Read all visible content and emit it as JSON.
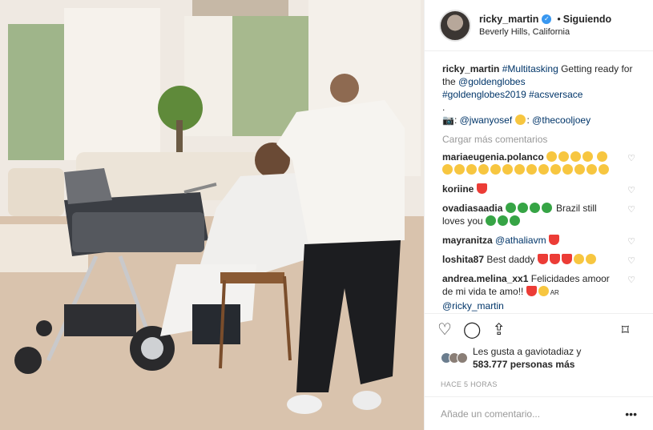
{
  "header": {
    "username": "ricky_martin",
    "separator": "•",
    "follow_status": "Siguiendo",
    "location": "Beverly Hills, California"
  },
  "caption": {
    "username": "ricky_martin",
    "hashtag1": "#Multitasking",
    "text1": " Getting ready for the ",
    "mention1": "@goldenglobes",
    "hashtag2": "#goldenglobes2019",
    "hashtag3": "#acsversace",
    "dot_line": ".",
    "camera": "📷: ",
    "mention2": "@jwanyosef",
    "mention3": "@thecooljoey"
  },
  "load_more": "Cargar más comentarios",
  "comments": [
    {
      "user": "mariaeugenia.polanco",
      "text": ""
    },
    {
      "user": "koriine",
      "text": ""
    },
    {
      "user": "ovadiasaadia",
      "text": " Brazil still loves you"
    },
    {
      "user": "mayranitza",
      "text": "",
      "mention": "@athaliavm"
    },
    {
      "user": "loshita87",
      "text": " Best daddy"
    },
    {
      "user": "andrea.melina_xx1",
      "text": " Felicidades amoor de mi vida te amo!! ",
      "mention": "@ricky_martin",
      "suffix": "AR"
    }
  ],
  "likes": {
    "line1": "Les gusta a gaviotadiaz y",
    "line2": "583.777 personas más"
  },
  "timestamp": "HACE 5 HORAS",
  "add_comment": {
    "placeholder": "Añade un comentario...",
    "more": "•••"
  },
  "icons": {
    "like": "heart-icon",
    "comment": "comment-icon",
    "share": "share-icon",
    "save": "bookmark-icon"
  }
}
